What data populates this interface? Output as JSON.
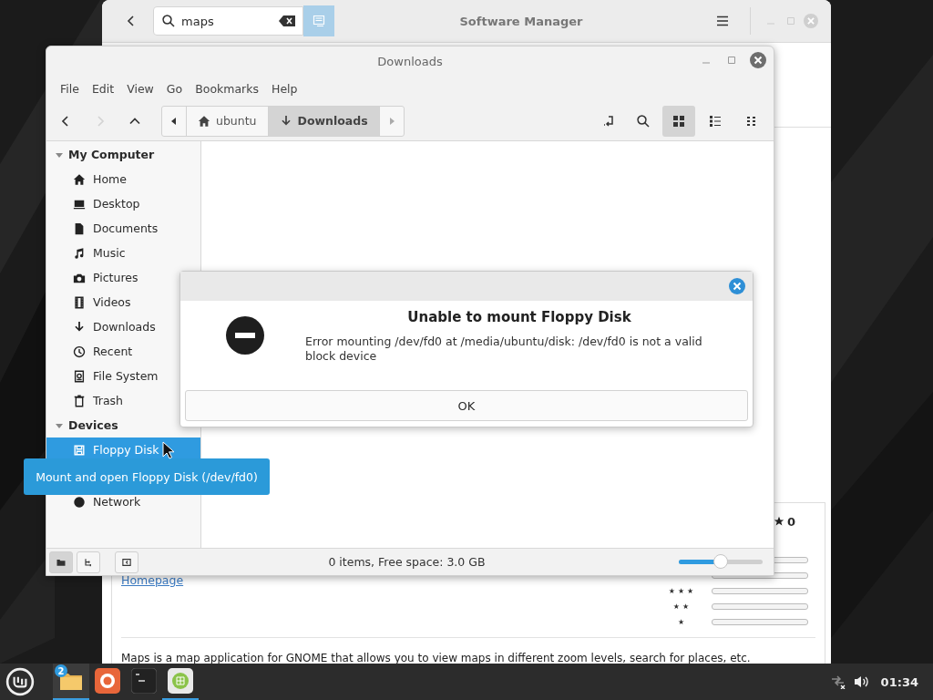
{
  "software_manager": {
    "title": "Software Manager",
    "search": {
      "value": "maps"
    },
    "search_options_on": true,
    "homepage_link": "Homepage",
    "rating": {
      "count": "0",
      "rows": [
        {
          "level": 0
        },
        {
          "level": 0
        },
        {
          "label": "★★★",
          "level": 0
        },
        {
          "label": "★★",
          "level": 0
        },
        {
          "label": "★",
          "level": 0
        }
      ]
    },
    "description": "Maps is a map application for GNOME that allows you to view maps in different zoom levels, search for places, etc."
  },
  "file_manager": {
    "title": "Downloads",
    "menu": [
      "File",
      "Edit",
      "View",
      "Go",
      "Bookmarks",
      "Help"
    ],
    "nav_buttons": [
      {
        "disabled": false
      },
      {
        "disabled": true
      },
      {
        "disabled": false
      }
    ],
    "breadcrumbs": [
      {
        "label": "ubuntu",
        "selected": false
      },
      {
        "label": "Downloads",
        "selected": true
      }
    ],
    "view_modes": [
      {
        "selected": true
      },
      {
        "selected": false
      },
      {
        "selected": false
      }
    ],
    "sidebar": [
      {
        "title": "My Computer",
        "expanded": true,
        "items": [
          {
            "label": "Home",
            "selected": false
          },
          {
            "label": "Desktop",
            "selected": false
          },
          {
            "label": "Documents",
            "selected": false
          },
          {
            "label": "Music",
            "selected": false
          },
          {
            "label": "Pictures",
            "selected": false
          },
          {
            "label": "Videos",
            "selected": false
          },
          {
            "label": "Downloads",
            "selected": false
          },
          {
            "label": "Recent",
            "selected": false
          },
          {
            "label": "File System",
            "selected": false
          },
          {
            "label": "Trash",
            "selected": false
          }
        ]
      },
      {
        "title": "Devices",
        "expanded": true,
        "items": [
          {
            "label": "Floppy Disk",
            "selected": true
          },
          {
            "label": "Network",
            "selected": false
          }
        ]
      }
    ],
    "pane_buttons": [
      {
        "selected": true
      },
      {
        "selected": false
      },
      {
        "selected": false
      }
    ],
    "status": "0 items, Free space: 3.0 GB",
    "zoom": {
      "level": 0.5
    }
  },
  "dialog": {
    "title": "Unable to mount Floppy Disk",
    "message": "Error mounting /dev/fd0 at /media/ubuntu/disk: /dev/fd0 is not a valid block device",
    "button": "OK"
  },
  "tooltip": "Mount and open Floppy Disk (/dev/fd0)",
  "taskbar": {
    "apps": [
      {
        "active": true,
        "badge": "2"
      },
      {
        "active": false
      },
      {
        "active": false
      },
      {
        "active": true
      }
    ],
    "clock": "01:34"
  }
}
